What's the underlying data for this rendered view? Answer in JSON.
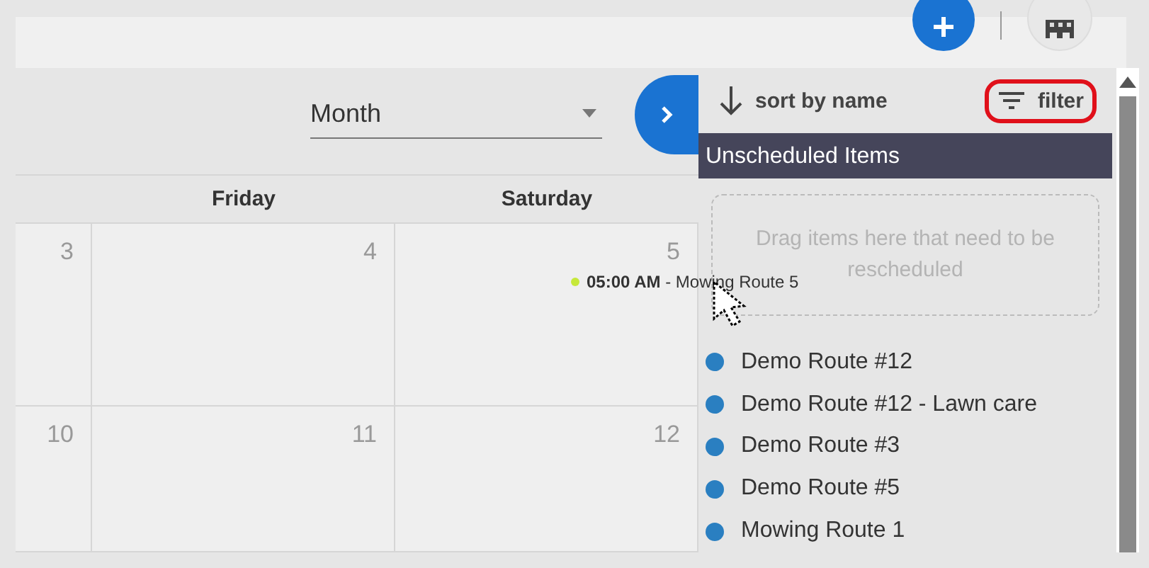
{
  "view_select": {
    "value": "Month"
  },
  "calendar": {
    "columns": [
      "Friday",
      "Saturday"
    ],
    "weeks": [
      {
        "days": [
          {
            "number": "3"
          },
          {
            "number": "4"
          },
          {
            "number": "5",
            "events": [
              {
                "time": "05:00 AM",
                "title": "- Mowing Route 5",
                "color": "#c6e83a"
              }
            ]
          }
        ]
      },
      {
        "days": [
          {
            "number": "10"
          },
          {
            "number": "11"
          },
          {
            "number": "12"
          }
        ]
      }
    ]
  },
  "sort": {
    "label": "sort by name"
  },
  "filter": {
    "label": "filter",
    "highlighted": true
  },
  "unscheduled": {
    "title": "Unscheduled Items",
    "drop_hint": "Drag items here that need to be rescheduled",
    "items": [
      {
        "label": "Demo Route #12",
        "color": "#2a7fc1"
      },
      {
        "label": "Demo Route #12 - Lawn care",
        "color": "#2a7fc1"
      },
      {
        "label": "Demo Route #3",
        "color": "#2a7fc1"
      },
      {
        "label": "Demo Route #5",
        "color": "#2a7fc1"
      },
      {
        "label": "Mowing Route 1",
        "color": "#2a7fc1"
      }
    ]
  }
}
